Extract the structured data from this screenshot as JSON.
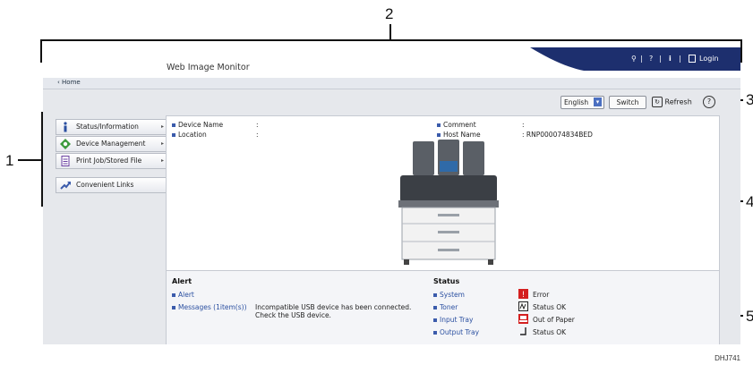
{
  "callouts": {
    "n1": "1",
    "n2": "2",
    "n3": "3",
    "n4": "4",
    "n5": "5"
  },
  "header": {
    "title": "Web Image Monitor",
    "util": {
      "search": "⚲",
      "help": "?",
      "info": "i",
      "login": "Login"
    }
  },
  "breadcrumb": {
    "home": "‹ Home"
  },
  "toolbar": {
    "language": "English",
    "language_arrow": "▾",
    "switch_label": "Switch",
    "refresh_label": "Refresh",
    "help_icon": "?"
  },
  "sidebar": {
    "items": [
      {
        "label": "Status/Information",
        "icon": "info-icon"
      },
      {
        "label": "Device Management",
        "icon": "device-management-icon"
      },
      {
        "label": "Print Job/Stored File",
        "icon": "document-icon"
      },
      {
        "label": "Convenient Links",
        "icon": "link-arrow-icon"
      }
    ],
    "arrow": "▸"
  },
  "device_info": {
    "device_name_label": "Device Name",
    "device_name_value": ":",
    "location_label": "Location",
    "location_value": ":",
    "comment_label": "Comment",
    "comment_value": ":",
    "host_name_label": "Host Name",
    "host_name_value": ": RNP000074834BED"
  },
  "alert": {
    "title": "Alert",
    "alert_link": "Alert",
    "messages_link": "Messages (1item(s))",
    "message_line1": "Incompatible USB device has been connected.",
    "message_line2": "Check the USB device."
  },
  "status": {
    "title": "Status",
    "rows": [
      {
        "name": "System",
        "value": "Error",
        "icon": "error-icon"
      },
      {
        "name": "Toner",
        "value": "Status OK",
        "icon": "toner-icon"
      },
      {
        "name": "Input Tray",
        "value": "Out of Paper",
        "icon": "out-of-paper-icon"
      },
      {
        "name": "Output Tray",
        "value": "Status OK",
        "icon": "output-tray-icon"
      }
    ]
  },
  "figure_code": "DHJ741",
  "colors": {
    "accent": "#1d2f6e",
    "link": "#2a4fa0",
    "error": "#d42020"
  }
}
